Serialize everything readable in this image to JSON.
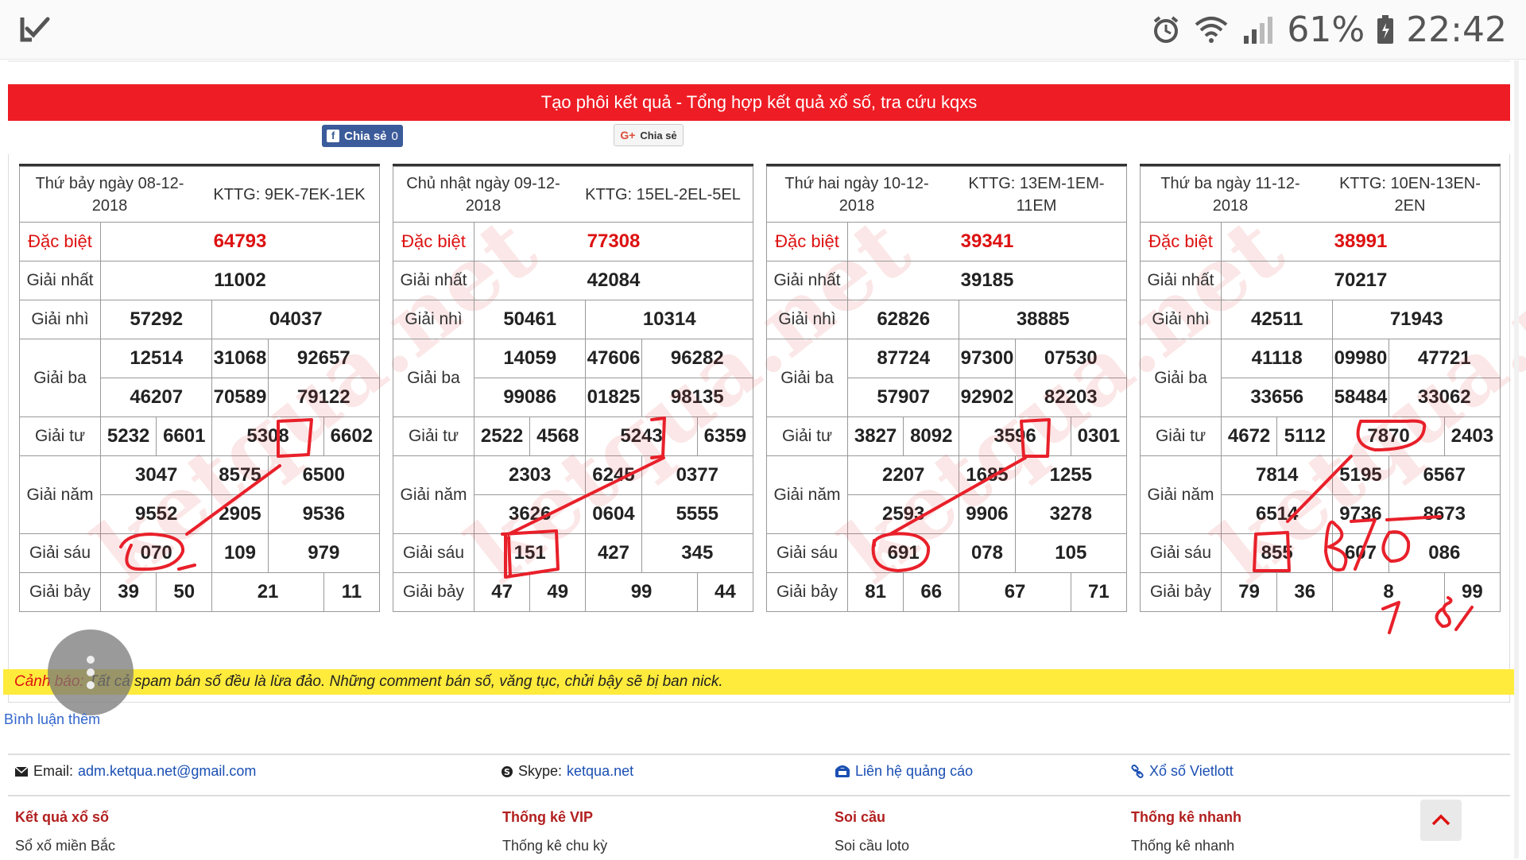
{
  "status_bar": {
    "battery_percent": "61%",
    "time": "22:42"
  },
  "banner": {
    "title": "Tạo phôi kết quả - Tổng hợp kết quả xổ số, tra cứu kqxs"
  },
  "share": {
    "facebook_label": "Chia sẻ",
    "facebook_count": "0",
    "google_label": "Chia sẻ"
  },
  "watermark": "ketqua.net",
  "tables": [
    {
      "date": "Thứ bảy ngày 08-12-2018",
      "kttg": "KTTG: 9EK-7EK-1EK",
      "dac_biet": "64793",
      "giai_nhat": "11002",
      "giai_nhi": [
        "57292",
        "04037"
      ],
      "giai_ba": [
        "12514",
        "31068",
        "92657",
        "46207",
        "70589",
        "79122"
      ],
      "giai_tu": [
        "5232",
        "6601",
        "5308",
        "6602"
      ],
      "giai_nam": [
        "3047",
        "8575",
        "6500",
        "9552",
        "2905",
        "9536"
      ],
      "giai_sau": [
        "070",
        "109",
        "979"
      ],
      "giai_bay": [
        "39",
        "50",
        "21",
        "11"
      ]
    },
    {
      "date": "Chủ nhật ngày 09-12-2018",
      "kttg": "KTTG: 15EL-2EL-5EL",
      "dac_biet": "77308",
      "giai_nhat": "42084",
      "giai_nhi": [
        "50461",
        "10314"
      ],
      "giai_ba": [
        "14059",
        "47606",
        "96282",
        "99086",
        "01825",
        "98135"
      ],
      "giai_tu": [
        "2522",
        "4568",
        "5243",
        "6359"
      ],
      "giai_nam": [
        "2303",
        "6245",
        "0377",
        "3626",
        "0604",
        "5555"
      ],
      "giai_sau": [
        "151",
        "427",
        "345"
      ],
      "giai_bay": [
        "47",
        "49",
        "99",
        "44"
      ]
    },
    {
      "date": "Thứ hai ngày 10-12-2018",
      "kttg": "KTTG: 13EM-1EM-11EM",
      "dac_biet": "39341",
      "giai_nhat": "39185",
      "giai_nhi": [
        "62826",
        "38885"
      ],
      "giai_ba": [
        "87724",
        "97300",
        "07530",
        "57907",
        "92902",
        "82203"
      ],
      "giai_tu": [
        "3827",
        "8092",
        "3596",
        "0301"
      ],
      "giai_nam": [
        "2207",
        "1685",
        "1255",
        "2593",
        "9906",
        "3278"
      ],
      "giai_sau": [
        "691",
        "078",
        "105"
      ],
      "giai_bay": [
        "81",
        "66",
        "67",
        "71"
      ]
    },
    {
      "date": "Thứ ba ngày 11-12-2018",
      "kttg": "KTTG: 10EN-13EN-2EN",
      "dac_biet": "38991",
      "giai_nhat": "70217",
      "giai_nhi": [
        "42511",
        "71943"
      ],
      "giai_ba": [
        "41118",
        "09980",
        "47721",
        "33656",
        "58484",
        "33062"
      ],
      "giai_tu": [
        "4672",
        "5112",
        "7870",
        "2403"
      ],
      "giai_nam": [
        "7814",
        "5195",
        "6567",
        "6514",
        "9736",
        "8673"
      ],
      "giai_sau": [
        "855",
        "607",
        "086"
      ],
      "giai_bay": [
        "79",
        "36",
        "8",
        "99"
      ]
    }
  ],
  "labels": {
    "dac_biet": "Đặc biệt",
    "giai_nhat": "Giải nhất",
    "giai_nhi": "Giải nhì",
    "giai_ba": "Giải ba",
    "giai_tu": "Giải tư",
    "giai_nam": "Giải năm",
    "giai_sau": "Giải sáu",
    "giai_bay": "Giải bảy"
  },
  "handwriting": "B70 78",
  "warning": {
    "prefix": "Cảnh báo:",
    "text": " Tất cả spam bán số đều là lừa đảo. Những comment bán số, văng tục, chửi bậy sẽ bị ban nick."
  },
  "more_comments": "Bình luận thêm",
  "contacts": {
    "email_label": "Email:",
    "email": "adm.ketqua.net@gmail.com",
    "skype_label": "Skype:",
    "skype": "ketqua.net",
    "ads": "Liên hệ quảng cáo",
    "vietlott": "Xổ số Vietlott"
  },
  "footer_cols": [
    {
      "title": "Kết quả xổ số",
      "sub": "Sổ xố miền Bắc"
    },
    {
      "title": "Thống kê VIP",
      "sub": "Thống kê chu kỳ"
    },
    {
      "title": "Soi cầu",
      "sub": "Soi cầu loto"
    },
    {
      "title": "Thống kê nhanh",
      "sub": "Thống kê nhanh"
    }
  ],
  "colors": {
    "banner_red": "#ee1c24",
    "warning_yellow": "#ffeb3b",
    "ink_red": "#e8202a",
    "link_blue": "#1a4fb3"
  }
}
